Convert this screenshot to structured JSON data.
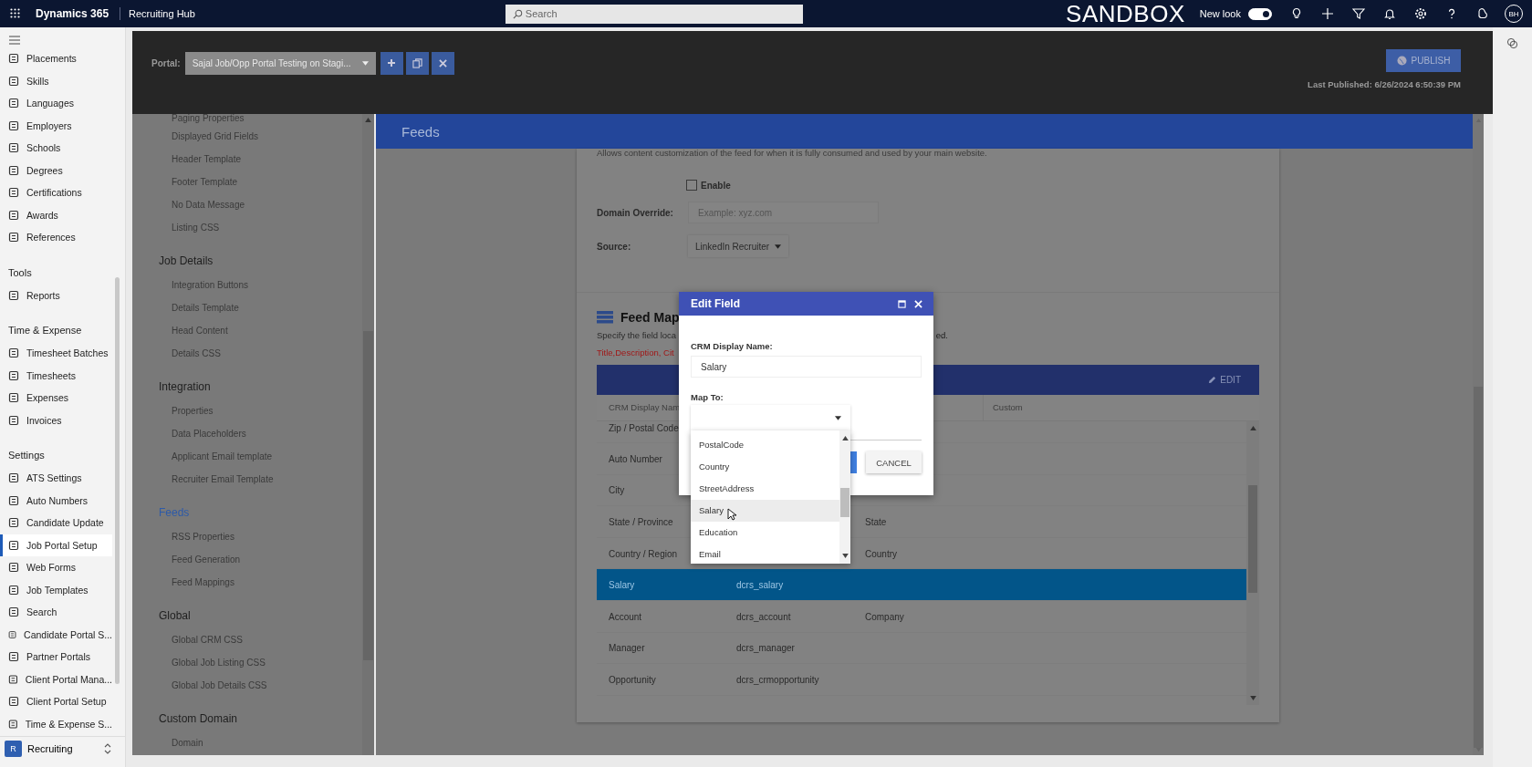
{
  "app_bar": {
    "app_name": "Dynamics 365",
    "area": "Recruiting Hub",
    "search": {
      "placeholder": "Search"
    },
    "environment": "SANDBOX",
    "new_look": {
      "label": "New look",
      "on": true
    },
    "avatar": "BH"
  },
  "nav": {
    "groups": [
      {
        "items": [
          {
            "label": "Placements",
            "selected": false
          },
          {
            "label": "Skills",
            "selected": false
          },
          {
            "label": "Languages",
            "selected": false
          },
          {
            "label": "Employers",
            "selected": false
          },
          {
            "label": "Schools",
            "selected": false
          },
          {
            "label": "Degrees",
            "selected": false
          },
          {
            "label": "Certifications",
            "selected": false
          },
          {
            "label": "Awards",
            "selected": false
          },
          {
            "label": "References",
            "selected": false
          }
        ]
      },
      {
        "title": "Tools",
        "items": [
          {
            "label": "Reports",
            "selected": false
          }
        ]
      },
      {
        "title": "Time & Expense",
        "items": [
          {
            "label": "Timesheet Batches",
            "selected": false
          },
          {
            "label": "Timesheets",
            "selected": false
          },
          {
            "label": "Expenses",
            "selected": false
          },
          {
            "label": "Invoices",
            "selected": false
          }
        ]
      },
      {
        "title": "Settings",
        "items": [
          {
            "label": "ATS Settings",
            "selected": false
          },
          {
            "label": "Auto Numbers",
            "selected": false
          },
          {
            "label": "Candidate Update",
            "selected": false
          },
          {
            "label": "Job Portal Setup",
            "selected": true
          },
          {
            "label": "Web Forms",
            "selected": false
          },
          {
            "label": "Job Templates",
            "selected": false
          },
          {
            "label": "Search",
            "selected": false
          },
          {
            "label": "Candidate Portal S...",
            "selected": false
          },
          {
            "label": "Partner Portals",
            "selected": false
          },
          {
            "label": "Client Portal Mana...",
            "selected": false
          },
          {
            "label": "Client Portal Setup",
            "selected": false
          },
          {
            "label": "Time & Expense S...",
            "selected": false
          }
        ]
      }
    ],
    "area_switcher": {
      "badge": "R",
      "label": "Recruiting"
    }
  },
  "portal_bar": {
    "label": "Portal:",
    "portal": "Sajal Job/Opp Portal Testing on Stagi...",
    "publish": "PUBLISH",
    "last_published": "Last Published: 6/26/2024 6:50:39 PM"
  },
  "settings_menu": {
    "sections": [
      {
        "items": [
          "Paging Properties",
          "Displayed Grid Fields",
          "Header Template",
          "Footer Template",
          "No Data Message",
          "Listing CSS"
        ]
      },
      {
        "title": "Job Details",
        "selected": false,
        "items": [
          "Integration Buttons",
          "Details Template",
          "Head Content",
          "Details CSS"
        ]
      },
      {
        "title": "Integration",
        "selected": false,
        "items": [
          "Properties",
          "Data Placeholders",
          "Applicant Email template",
          "Recruiter Email Template"
        ]
      },
      {
        "title": "Feeds",
        "selected": true,
        "items": [
          "RSS Properties",
          "Feed Generation",
          "Feed Mappings"
        ]
      },
      {
        "title": "Global",
        "selected": false,
        "items": [
          "Global CRM CSS",
          "Global Job Listing CSS",
          "Global Job Details CSS"
        ]
      },
      {
        "title": "Custom Domain",
        "selected": false,
        "items": [
          "Domain"
        ]
      }
    ]
  },
  "page": {
    "title": "Feeds",
    "description": "Allows content customization of the feed for when it is fully consumed and used by your main website.",
    "enable": {
      "label": "Enable",
      "checked": false
    },
    "domain_override": {
      "label": "Domain Override:",
      "placeholder": "Example: xyz.com"
    },
    "source": {
      "label": "Source:",
      "value": "LinkedIn Recruiter"
    },
    "feed_mappings": {
      "title": "Feed Map",
      "description": "Specify the field loca",
      "description_end": "ed.",
      "required": "Title,Description, Cit",
      "action": "EDIT",
      "column_1": "CRM Display Nam",
      "column_4": "Custom",
      "rows": [
        {
          "column_1": "Zip / Postal Code",
          "selected": false
        },
        {
          "column_1": "Auto Number",
          "selected": false
        },
        {
          "column_1": "City",
          "selected": false
        },
        {
          "column_1": "State / Province",
          "column_3": "State",
          "selected": false
        },
        {
          "column_1": "Country / Region",
          "column_3": "Country",
          "selected": false
        },
        {
          "column_1": "Salary",
          "column_2": "dcrs_salary",
          "selected": true
        },
        {
          "column_1": "Account",
          "column_2": "dcrs_account",
          "column_3": "Company",
          "selected": false
        },
        {
          "column_1": "Manager",
          "column_2": "dcrs_manager",
          "selected": false
        },
        {
          "column_1": "Opportunity",
          "column_2": "dcrs_crmopportunity",
          "selected": false
        }
      ]
    }
  },
  "dialog": {
    "title": "Edit Field",
    "name_label": "CRM Display Name:",
    "name_value": "Salary",
    "map_label": "Map To:",
    "cancel": "CANCEL",
    "options": [
      {
        "label": "PostalCode",
        "hovered": false
      },
      {
        "label": "Country",
        "hovered": false
      },
      {
        "label": "StreetAddress",
        "hovered": false
      },
      {
        "label": "Salary",
        "hovered": true
      },
      {
        "label": "Education",
        "hovered": false
      },
      {
        "label": "Email",
        "hovered": false
      }
    ]
  }
}
